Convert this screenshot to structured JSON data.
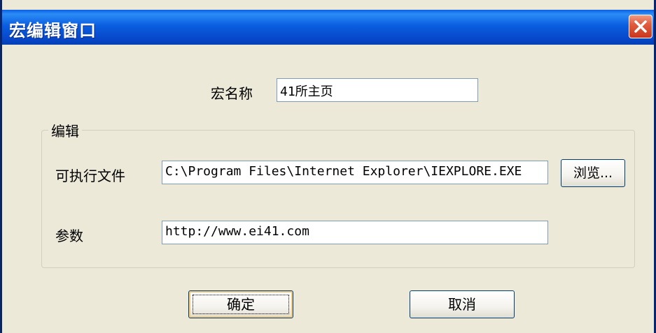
{
  "window": {
    "title": "宏编辑窗口"
  },
  "form": {
    "macro_name_label": "宏名称",
    "macro_name_value": "41所主页",
    "group_label": "编辑",
    "executable_label": "可执行文件",
    "executable_value": "C:\\Program Files\\Internet Explorer\\IEXPLORE.EXE",
    "browse_label": "浏览...",
    "params_label": "参数",
    "params_value": "http://www.ei41.com"
  },
  "buttons": {
    "ok_label": "确定",
    "cancel_label": "取消"
  },
  "icons": {
    "close": "close-icon"
  },
  "colors": {
    "titlebar": "#0a5ee0",
    "dialog_bg": "#ece9d8",
    "close_button": "#e25c3e"
  }
}
